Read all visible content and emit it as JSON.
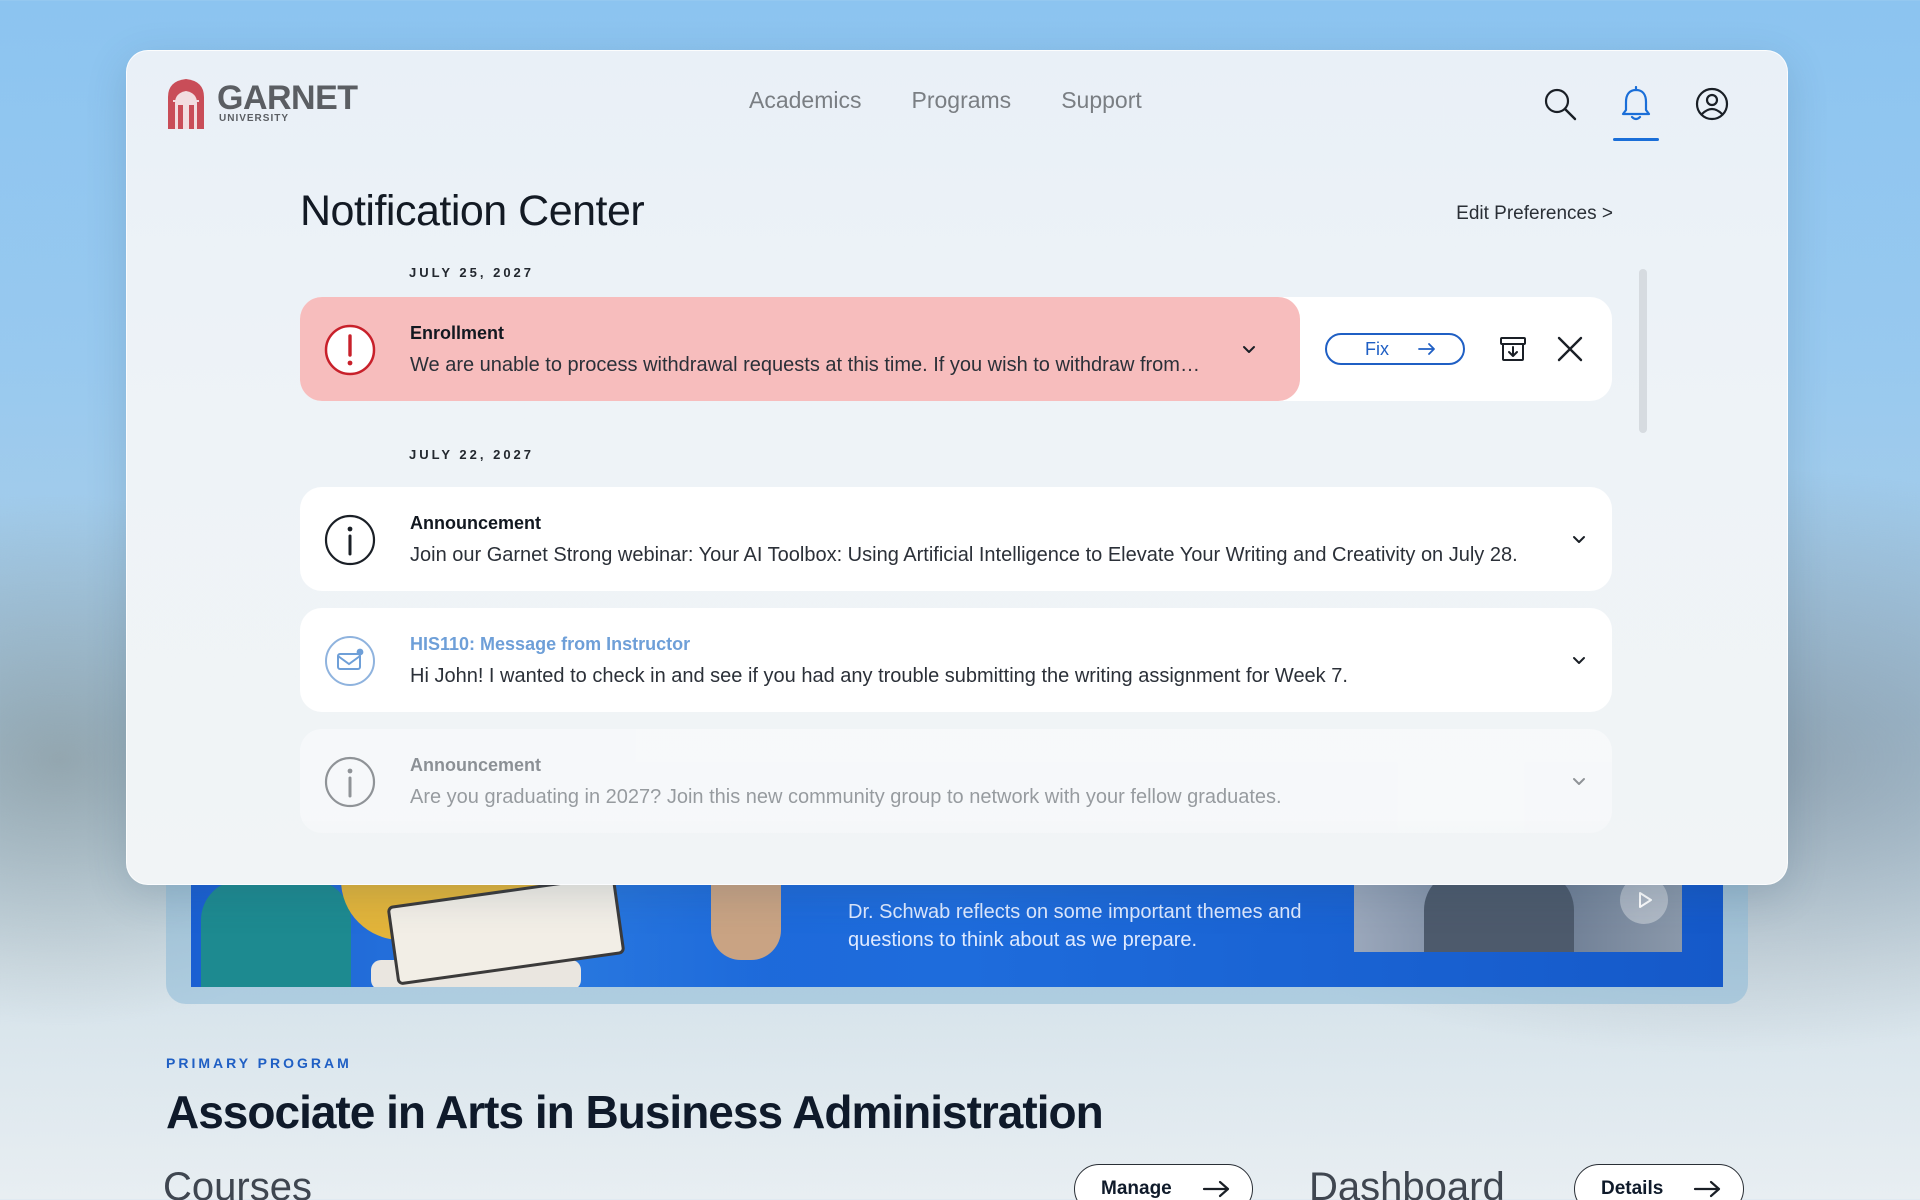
{
  "brand": {
    "name": "GARNET",
    "sub": "UNIVERSITY",
    "color": "#c94d58"
  },
  "nav": {
    "items": [
      "Academics",
      "Programs",
      "Support"
    ]
  },
  "top_icons": {
    "search": "search-icon",
    "notifications": "bell-icon",
    "account": "user-circle-icon",
    "accent": "#1a6ed8"
  },
  "notification_center": {
    "title": "Notification Center",
    "edit_preferences": "Edit Preferences >",
    "groups": [
      {
        "date": "JULY 25, 2027",
        "items": [
          {
            "type": "alert",
            "icon": "exclamation-circle-icon",
            "title": "Enrollment",
            "body": "We are unable to process withdrawal requests at this time. If you wish to withdraw from your course, please contact your advisor.",
            "fix_label": "Fix",
            "archive_icon": "archive-icon",
            "dismiss_icon": "close-icon",
            "bg_color": "#f7bdbd"
          }
        ]
      },
      {
        "date": "JULY 22, 2027",
        "items": [
          {
            "type": "info",
            "icon": "info-circle-icon",
            "title": "Announcement",
            "body": "Join our Garnet Strong webinar: Your AI Toolbox: Using Artificial Intelligence to Elevate Your Writing and Creativity on July 28."
          },
          {
            "type": "message",
            "icon": "mail-icon",
            "title": "HIS110: Message from Instructor",
            "body": "Hi John! I wanted to check in and see if you had any trouble submitting the writing assignment for Week 7."
          },
          {
            "type": "info",
            "icon": "info-circle-icon",
            "title": "Announcement",
            "body": "Are you graduating in 2027? Join this new community group to network with your fellow graduates."
          }
        ]
      }
    ]
  },
  "background_page": {
    "banner_text": "Dr. Schwab reflects on some important themes and questions to think about as we prepare.",
    "play_icon": "play-icon",
    "eyebrow": "PRIMARY PROGRAM",
    "program_title": "Associate in Arts in Business Administration",
    "courses_heading": "Courses",
    "manage_label": "Manage",
    "dashboard_heading": "Dashboard",
    "details_label": "Details"
  }
}
